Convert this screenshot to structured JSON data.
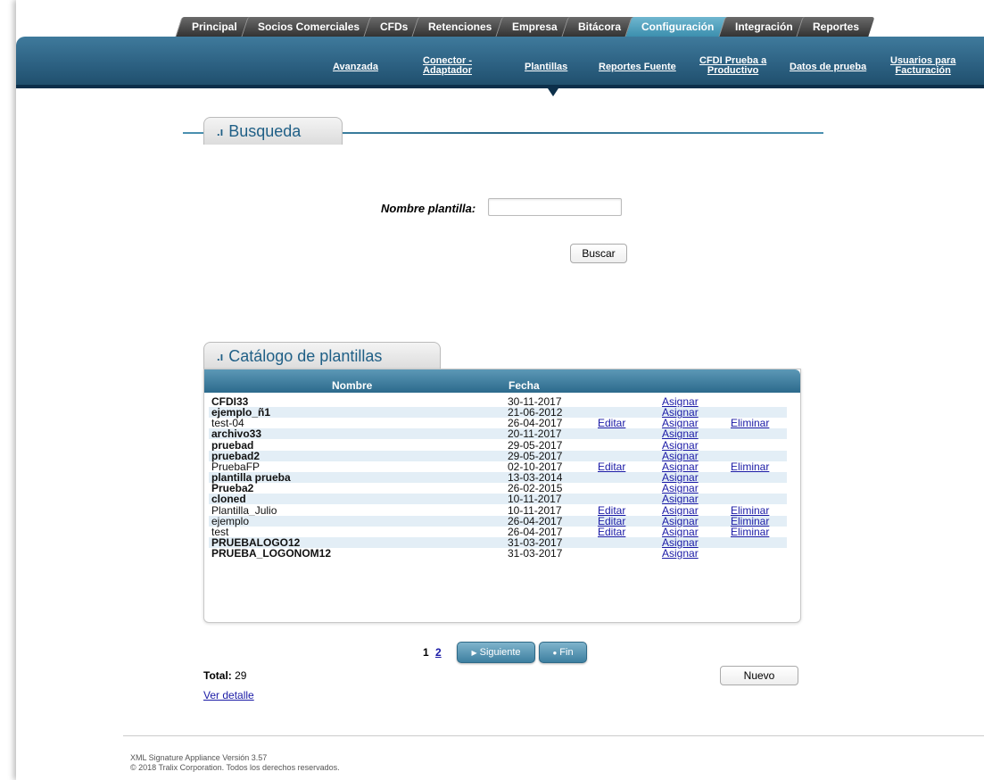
{
  "tabs": [
    {
      "label": "Principal"
    },
    {
      "label": "Socios Comerciales"
    },
    {
      "label": "CFDs"
    },
    {
      "label": "Retenciones"
    },
    {
      "label": "Empresa"
    },
    {
      "label": "Bitácora"
    },
    {
      "label": "Configuración"
    },
    {
      "label": "Integración"
    },
    {
      "label": "Reportes"
    }
  ],
  "subnav": {
    "avanzada": "Avanzada",
    "conector_1": "Conector -",
    "conector_2": "Adaptador",
    "plantillas": "Plantillas",
    "reportes_fuente": "Reportes Fuente",
    "cfdi_1": "CFDI Prueba a",
    "cfdi_2": "Productivo",
    "datos_prueba": "Datos de prueba",
    "usuarios_1": "Usuarios para",
    "usuarios_2": "Facturación"
  },
  "search": {
    "section_title": "Busqueda",
    "field_label": "Nombre plantilla:",
    "field_value": "",
    "button": "Buscar"
  },
  "catalog": {
    "section_title": "Catálogo de plantillas",
    "col_nombre": "Nombre",
    "col_fecha": "Fecha",
    "rows": [
      {
        "name": "CFDI33",
        "date": "30-11-2017",
        "edit": "",
        "assign": "Asignar",
        "delete": ""
      },
      {
        "name": "ejemplo_ñ1",
        "date": "21-06-2012",
        "edit": "",
        "assign": "Asignar",
        "delete": ""
      },
      {
        "name": "test-04",
        "date": "26-04-2017",
        "edit": "Editar",
        "assign": "Asignar",
        "delete": "Eliminar"
      },
      {
        "name": "archivo33",
        "date": "20-11-2017",
        "edit": "",
        "assign": "Asignar",
        "delete": ""
      },
      {
        "name": "pruebad",
        "date": "29-05-2017",
        "edit": "",
        "assign": "Asignar",
        "delete": ""
      },
      {
        "name": "pruebad2",
        "date": "29-05-2017",
        "edit": "",
        "assign": "Asignar",
        "delete": ""
      },
      {
        "name": "PruebaFP",
        "date": "02-10-2017",
        "edit": "Editar",
        "assign": "Asignar",
        "delete": "Eliminar"
      },
      {
        "name": "plantilla prueba",
        "date": "13-03-2014",
        "edit": "",
        "assign": "Asignar",
        "delete": ""
      },
      {
        "name": "Prueba2",
        "date": "26-02-2015",
        "edit": "",
        "assign": "Asignar",
        "delete": ""
      },
      {
        "name": "cloned",
        "date": "10-11-2017",
        "edit": "",
        "assign": "Asignar",
        "delete": ""
      },
      {
        "name": "Plantilla_Julio",
        "date": "10-11-2017",
        "edit": "Editar",
        "assign": "Asignar",
        "delete": "Eliminar"
      },
      {
        "name": "ejemplo",
        "date": "26-04-2017",
        "edit": "Editar",
        "assign": "Asignar",
        "delete": "Eliminar"
      },
      {
        "name": "test",
        "date": "26-04-2017",
        "edit": "Editar",
        "assign": "Asignar",
        "delete": "Eliminar"
      },
      {
        "name": "PRUEBALOGO12",
        "date": "31-03-2017",
        "edit": "",
        "assign": "Asignar",
        "delete": ""
      },
      {
        "name": "PRUEBA_LOGONOM12",
        "date": "31-03-2017",
        "edit": "",
        "assign": "Asignar",
        "delete": ""
      }
    ]
  },
  "pager": {
    "page1": "1",
    "page2": "2",
    "next": "Siguiente",
    "end": "Fin"
  },
  "total": {
    "label": "Total:",
    "value": "29"
  },
  "nuevo": "Nuevo",
  "ver_detalle": "Ver detalle",
  "footer": {
    "line1": "XML Signature Appliance Versión 3.57",
    "line2": "© 2018 Tralix Corporation. Todos los derechos reservados."
  }
}
